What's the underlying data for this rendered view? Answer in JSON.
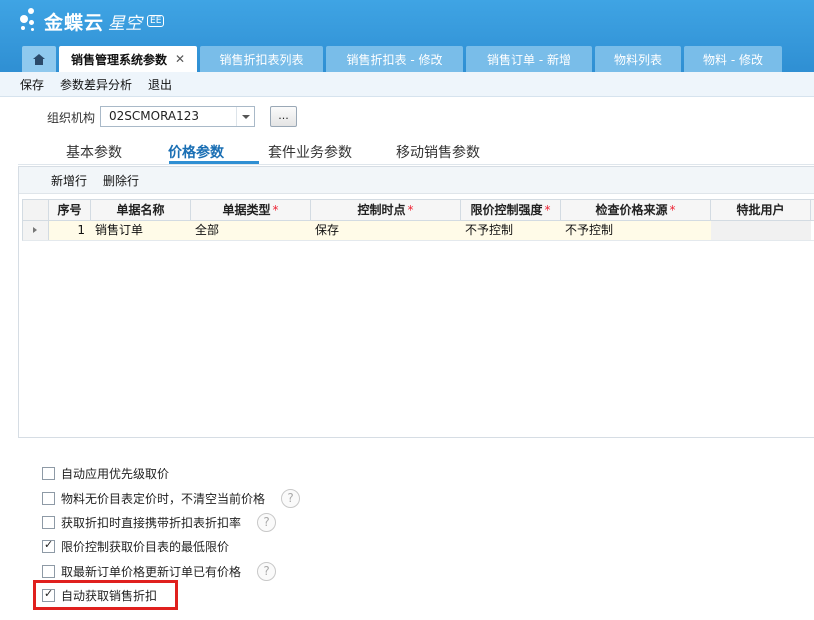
{
  "brand": {
    "logo_text": "金蝶云",
    "logo_sub": "星空",
    "badge": "EE"
  },
  "tabs": [
    {
      "label": "销售管理系统参数",
      "close": "✕"
    },
    {
      "label": "销售折扣表列表"
    },
    {
      "label": "销售折扣表 - 修改"
    },
    {
      "label": "销售订单 - 新增"
    },
    {
      "label": "物料列表"
    },
    {
      "label": "物料 - 修改"
    }
  ],
  "toolbar": {
    "save": "保存",
    "diff": "参数差异分析",
    "exit": "退出"
  },
  "org": {
    "label": "组织机构",
    "value": "02SCMORA123",
    "browse": "..."
  },
  "param_tabs": [
    "基本参数",
    "价格参数",
    "套件业务参数",
    "移动销售参数"
  ],
  "grid_toolbar": {
    "add": "新增行",
    "delete": "删除行"
  },
  "grid": {
    "columns": [
      "序号",
      "单据名称",
      "单据类型",
      "控制时点",
      "限价控制强度",
      "检查价格来源",
      "特批用户"
    ],
    "required_mark": "*",
    "rows": [
      {
        "seq": "1",
        "name": "销售订单",
        "type": "全部",
        "point": "保存",
        "strength": "不予控制",
        "source": "不予控制",
        "user": ""
      }
    ]
  },
  "options": [
    {
      "label": "自动应用优先级取价",
      "checked": false,
      "help": false
    },
    {
      "label": "物料无价目表定价时，不清空当前价格",
      "checked": false,
      "help": true
    },
    {
      "label": "获取折扣时直接携带折扣表折扣率",
      "checked": false,
      "help": true
    },
    {
      "label": "限价控制获取价目表的最低限价",
      "checked": true,
      "help": false
    },
    {
      "label": "取最新订单价格更新订单已有价格",
      "checked": false,
      "help": true
    },
    {
      "label": "自动获取销售折扣",
      "checked": true,
      "help": false
    }
  ],
  "help_glyph": "?"
}
